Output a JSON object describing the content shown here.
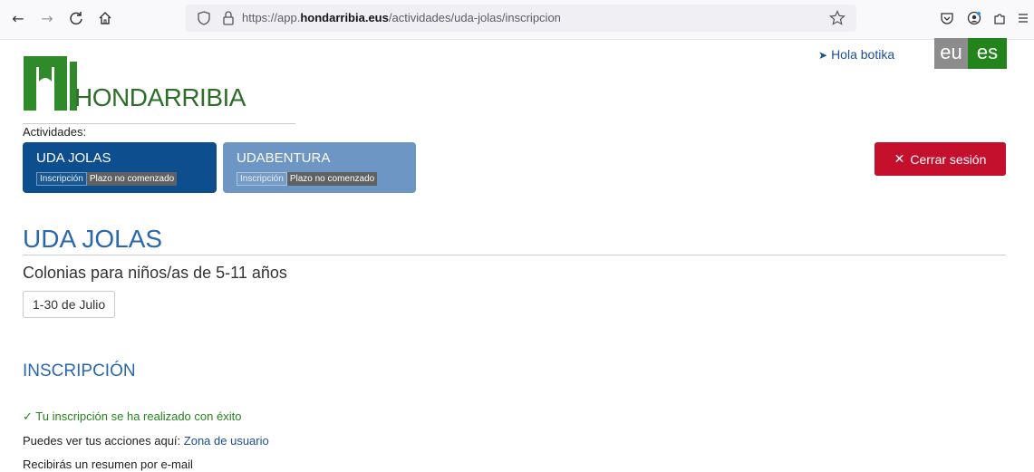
{
  "browser": {
    "url_prefix": "https://app.",
    "url_domain": "hondarribia.eus",
    "url_path": "/actividades/uda-jolas/inscripcion"
  },
  "header": {
    "logo_text": "HONDARRIBIA",
    "greeting": "Hola botika",
    "lang_eu": "eu",
    "lang_es": "es",
    "logout_label": "Cerrar sesión"
  },
  "activities": {
    "label": "Actividades:",
    "items": [
      {
        "name": "UDA JOLAS",
        "tag": "Inscripción",
        "status": "Plazo no comenzado"
      },
      {
        "name": "UDABENTURA",
        "tag": "Inscripción",
        "status": "Plazo no comenzado"
      }
    ]
  },
  "main": {
    "title": "UDA JOLAS",
    "subtitle": "Colonias para niños/as de 5-11 años",
    "dates": "1-30 de Julio",
    "section_title": "INSCRIPCIÓN",
    "success_msg": "Tu inscripción se ha realizado con éxito",
    "actions_prefix": "Puedes ver tus acciones aquí: ",
    "actions_link": "Zona de usuario",
    "summary_msg": "Recibirás un resumen por e-mail"
  },
  "colors": {
    "brand_green": "#23841b",
    "primary_blue": "#2a67ad",
    "dark_blue": "#0d4f8e",
    "logout_red": "#c40f2d"
  }
}
